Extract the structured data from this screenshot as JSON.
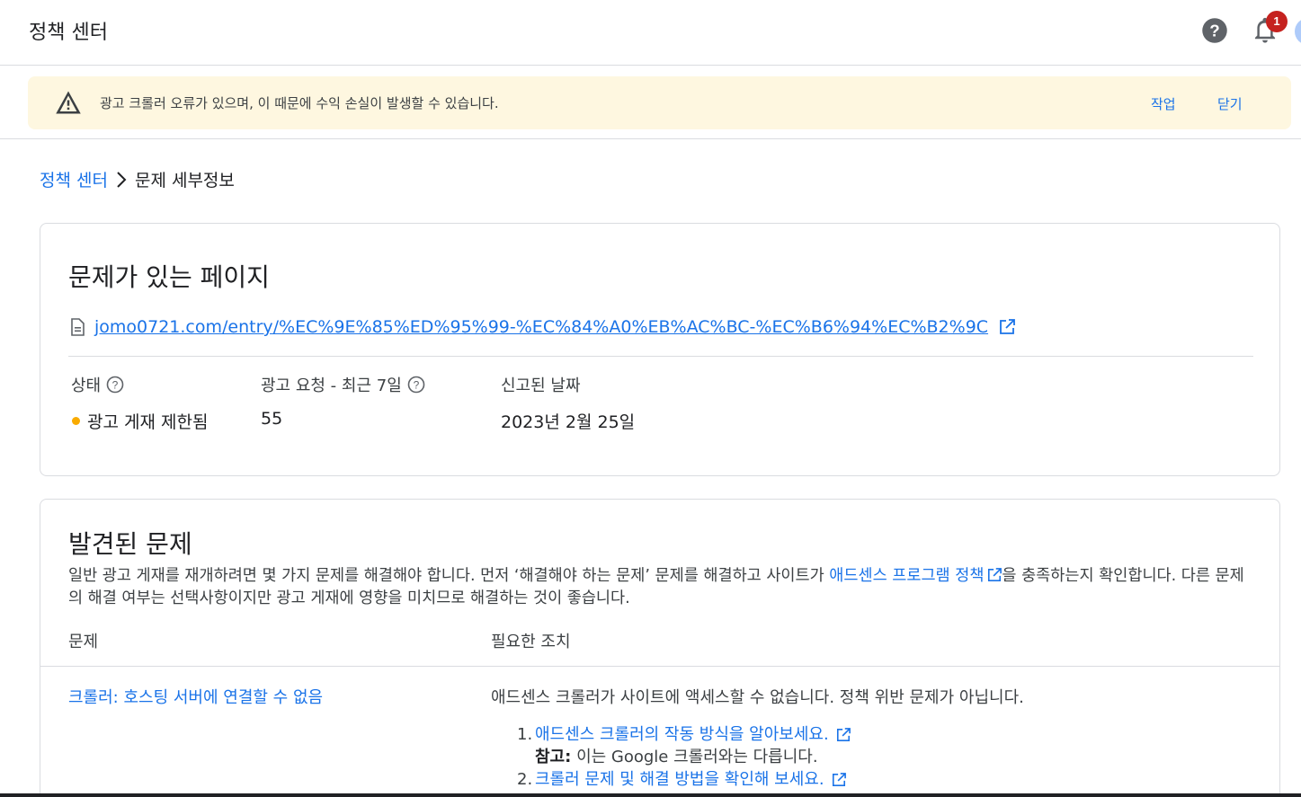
{
  "header": {
    "title": "정책 센터",
    "notification_count": "1"
  },
  "banner": {
    "message": "광고 크롤러 오류가 있으며, 이 때문에 수익 손실이 발생할 수 있습니다.",
    "action_label": "작업",
    "close_label": "닫기"
  },
  "breadcrumb": {
    "parent": "정책 센터",
    "current": "문제 세부정보"
  },
  "page_card": {
    "title": "문제가 있는 페이지",
    "url": "jomo0721.com/entry/%EC%9E%85%ED%95%99-%EC%84%A0%EB%AC%BC-%EC%B6%94%EC%B2%9C",
    "columns": {
      "status_label": "상태",
      "requests_label": "광고 요청 - 최근 7일",
      "reported_label": "신고된 날짜"
    },
    "values": {
      "status": "광고 게재 제한됨",
      "requests": "55",
      "reported": "2023년 2월 25일"
    }
  },
  "issues_card": {
    "title": "발견된 문제",
    "desc_part1": "일반 광고 게재를 재개하려면 몇 가지 문제를 해결해야 합니다. 먼저 ‘해결해야 하는 문제’ 문제를 해결하고 사이트가 ",
    "desc_link": "애드센스 프로그램 정책",
    "desc_part2": "을 충족하는지 확인합니다. 다른 문제의 해결 여부는 선택사항이지만 광고 게재에 영향을 미치므로 해결하는 것이 좋습니다.",
    "col_issue": "문제",
    "col_action": "필요한 조치",
    "issue": "크롤러: 호스팅 서버에 연결할 수 없음",
    "action": "애드센스 크롤러가 사이트에 액세스할 수 없습니다. 정책 위반 문제가 아닙니다.",
    "step1_num": "1.",
    "step1": "애드센스 크롤러의 작동 방식을 알아보세요.",
    "note_label": "참고:",
    "note_text": "이는 Google 크롤러와는 다릅니다.",
    "step2_num": "2.",
    "step2": "크롤러 문제 및 해결 방법을 확인해 보세요."
  },
  "colors": {
    "link": "#1a73e8",
    "banner_bg": "#fef7e0",
    "status_dot": "#f9ab00",
    "badge": "#c5221f"
  }
}
